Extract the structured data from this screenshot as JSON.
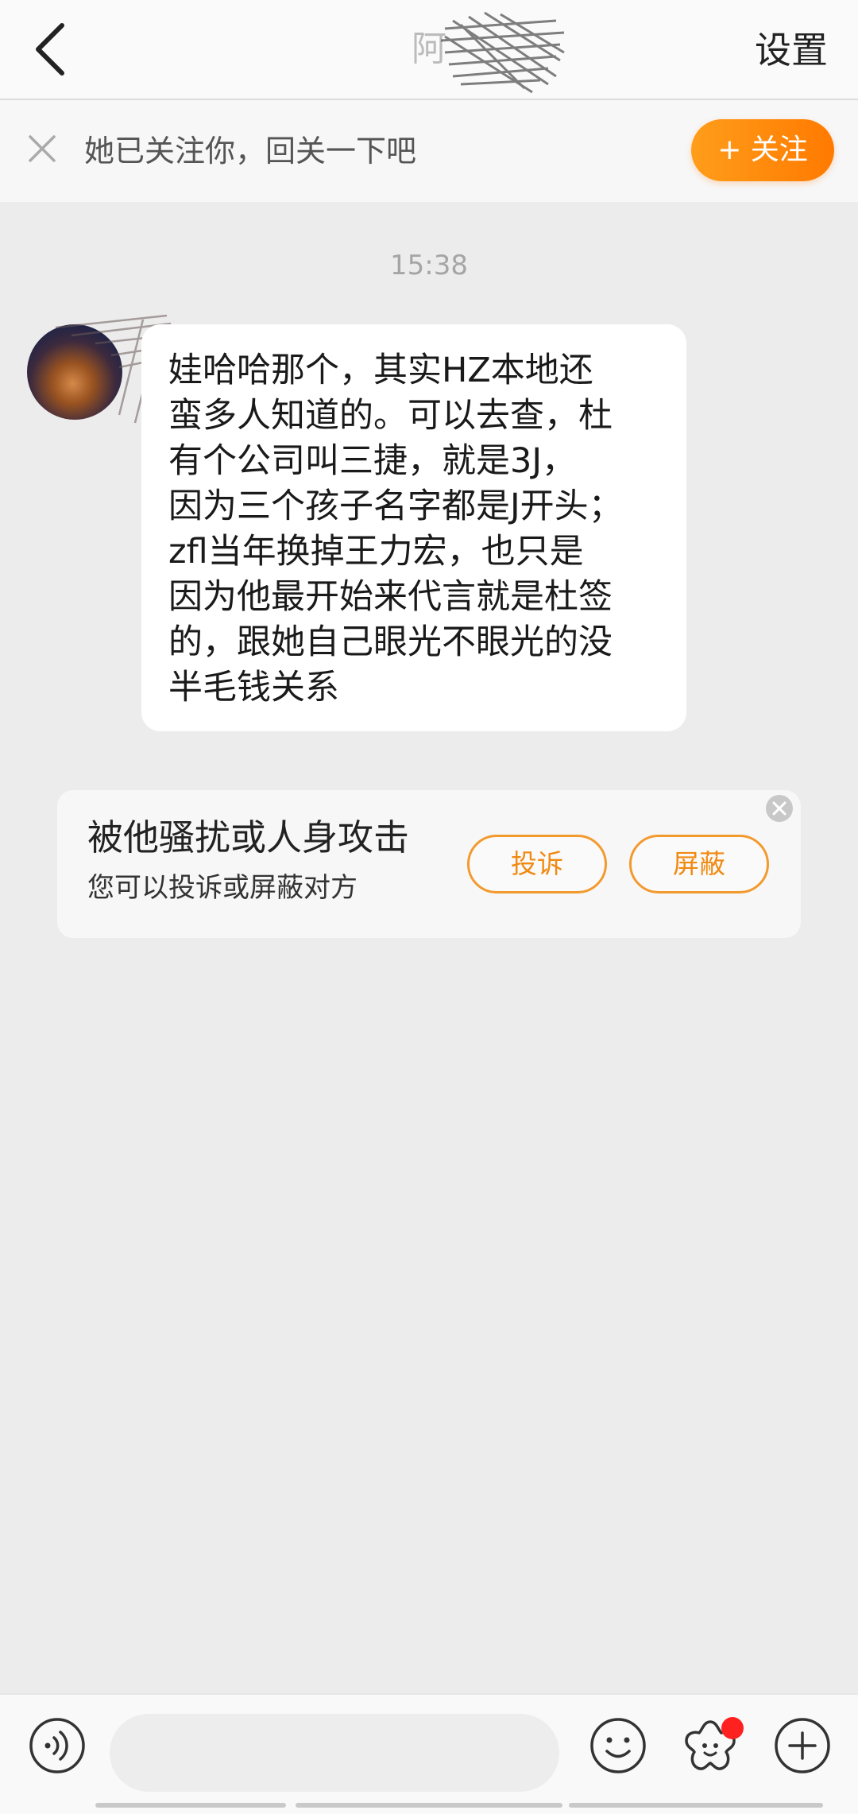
{
  "header": {
    "title": "阿",
    "settings_label": "设置"
  },
  "follow_bar": {
    "text": "她已关注你，回关一下吧",
    "button_label": "+ 关注"
  },
  "chat": {
    "timestamp": "15:38",
    "message_lines": [
      "娃哈哈那个，其实HZ本地还",
      "蛮多人知道的。可以去查，杜",
      "有个公司叫三捷，就是3J，",
      "因为三个孩子名字都是J开头；",
      "zfl当年换掉王力宏，也只是",
      "因为他最开始来代言就是杜签",
      "的，跟她自己眼光不眼光的没",
      "半毛钱关系"
    ]
  },
  "report_card": {
    "title": "被他骚扰或人身攻击",
    "subtitle": "您可以投诉或屏蔽对方",
    "complain_label": "投诉",
    "block_label": "屏蔽"
  },
  "input_bar": {
    "placeholder": ""
  },
  "icons": {
    "back": "chevron-left-icon",
    "close": "close-icon",
    "voice": "voice-icon",
    "emoji": "emoji-icon",
    "sticker": "flower-sticker-icon",
    "plus": "plus-icon"
  },
  "colors": {
    "accent": "#ff8a00",
    "notification_dot": "#ff2020",
    "background": "#ececec"
  }
}
